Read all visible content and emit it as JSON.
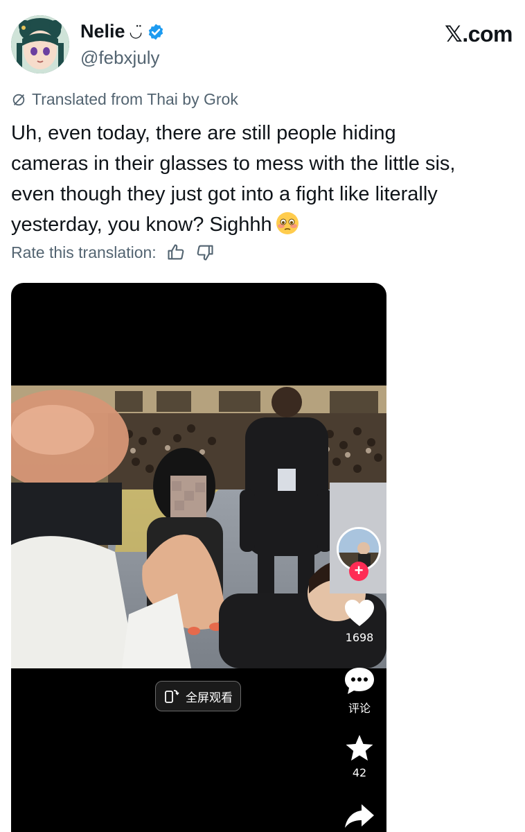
{
  "author": {
    "display_name": "Nelie",
    "name_emoji": "◡̈",
    "handle": "@febxjuly",
    "verified": true,
    "avatar_icon": "anime-avatar"
  },
  "brand": {
    "label": "𝕏.com"
  },
  "translation": {
    "notice": "Translated from Thai by Grok",
    "rate_label": "Rate this translation:"
  },
  "tweet": {
    "lines": [
      "Uh, even today, there are still people hiding",
      "cameras in their glasses to mess with the little sis,",
      "even though they just got into a fight like literally",
      "yesterday, you know? Sighhh"
    ],
    "emoji": "flushed-face"
  },
  "video": {
    "fullscreen_label": "全屏观看",
    "like_count": "1698",
    "comment_label": "评论",
    "favorite_count": "42"
  },
  "colors": {
    "verified": "#1d9bf0",
    "muted": "#536471",
    "follow_plus": "#fe2c55"
  }
}
